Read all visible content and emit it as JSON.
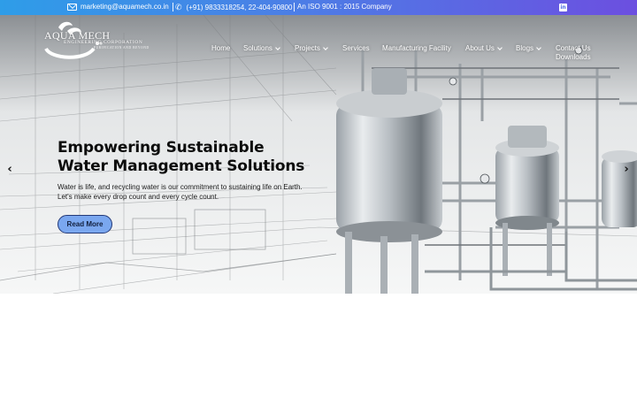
{
  "topbar": {
    "email": "marketing@aquamech.co.in",
    "phone": "(+91) 9833318254, 22-404-90800",
    "certification": "An ISO 9001 : 2015 Company",
    "icons": [
      "mail-icon",
      "phone-icon",
      "linkedin-icon"
    ],
    "colors": {
      "start": "#2e9de8",
      "end": "#6c4fe0"
    }
  },
  "logo": {
    "name": "AQUA MECH",
    "tagline": "ENGINEERING CORPORATION",
    "subtagline": "PURIFICATION AND BEYOND"
  },
  "nav": {
    "items": [
      {
        "label": "Home",
        "has_dropdown": false
      },
      {
        "label": "Solutions",
        "has_dropdown": true
      },
      {
        "label": "Projects",
        "has_dropdown": true
      },
      {
        "label": "Services",
        "has_dropdown": false
      },
      {
        "label": "Manufacturing Facility",
        "has_dropdown": false
      },
      {
        "label": "About Us",
        "has_dropdown": true
      },
      {
        "label": "Blogs",
        "has_dropdown": true
      },
      {
        "label": "Contact Us",
        "has_dropdown": false
      },
      {
        "label": "Downloads",
        "has_dropdown": false
      }
    ]
  },
  "hero": {
    "headline_line1": "Empowering Sustainable",
    "headline_line2": "Water Management Solutions",
    "subtext": "Water is life, and recycling water is our commitment to sustaining life on Earth. Let's make every drop count and every cycle count.",
    "cta_label": "Read More",
    "prev_arrow": "‹",
    "next_arrow": "›",
    "cta_color": "#7aa7ef"
  }
}
